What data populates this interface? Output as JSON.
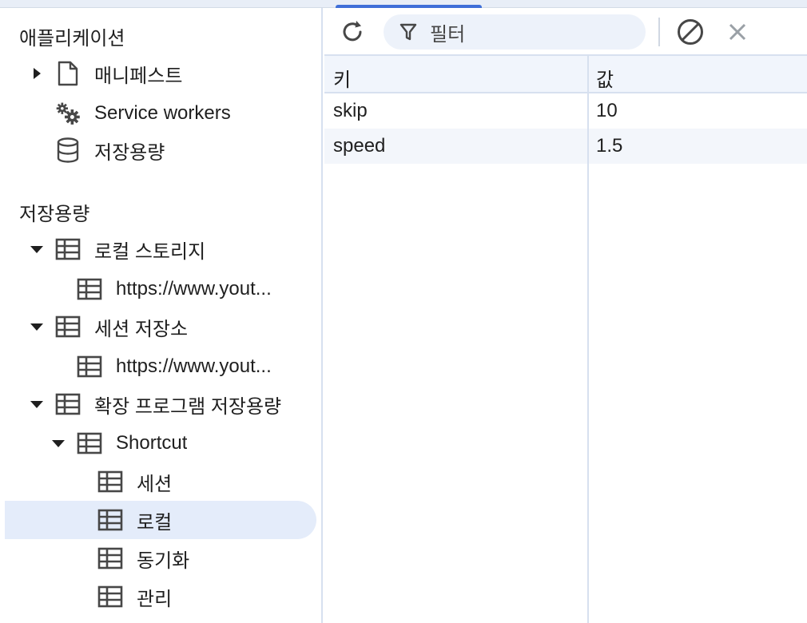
{
  "sidebar": {
    "app_section_title": "애플리케이션",
    "app_items": [
      {
        "label": "매니페스트",
        "icon": "file-icon"
      },
      {
        "label": "Service workers",
        "icon": "gears-icon"
      },
      {
        "label": "저장용량",
        "icon": "database-icon"
      }
    ],
    "storage_section_title": "저장용량",
    "storage_items": [
      {
        "label": "로컬 스토리지",
        "icon": "table-icon",
        "expanded": true
      },
      {
        "label": "https://www.yout...",
        "icon": "table-icon"
      },
      {
        "label": "세션 저장소",
        "icon": "table-icon",
        "expanded": true
      },
      {
        "label": "https://www.yout...",
        "icon": "table-icon"
      },
      {
        "label": "확장 프로그램 저장용량",
        "icon": "table-icon",
        "expanded": true
      },
      {
        "label": "Shortcut",
        "icon": "table-icon",
        "expanded": true
      },
      {
        "label": "세션",
        "icon": "table-icon"
      },
      {
        "label": "로컬",
        "icon": "table-icon",
        "selected": true
      },
      {
        "label": "동기화",
        "icon": "table-icon"
      },
      {
        "label": "관리",
        "icon": "table-icon"
      }
    ]
  },
  "toolbar": {
    "refresh_icon": "refresh-icon",
    "filter_placeholder": "필터",
    "clear_all_icon": "block-icon",
    "delete_icon": "close-icon"
  },
  "table": {
    "columns": [
      "키",
      "값"
    ],
    "rows": [
      {
        "key": "skip",
        "value": "10"
      },
      {
        "key": "speed",
        "value": "1.5"
      }
    ]
  },
  "colors": {
    "accent": "#3f6fd8",
    "selected_bg": "#e4ecfa",
    "header_bg": "#f1f5fc",
    "filter_bg": "#edf2fa",
    "border": "#d7e0ef"
  }
}
